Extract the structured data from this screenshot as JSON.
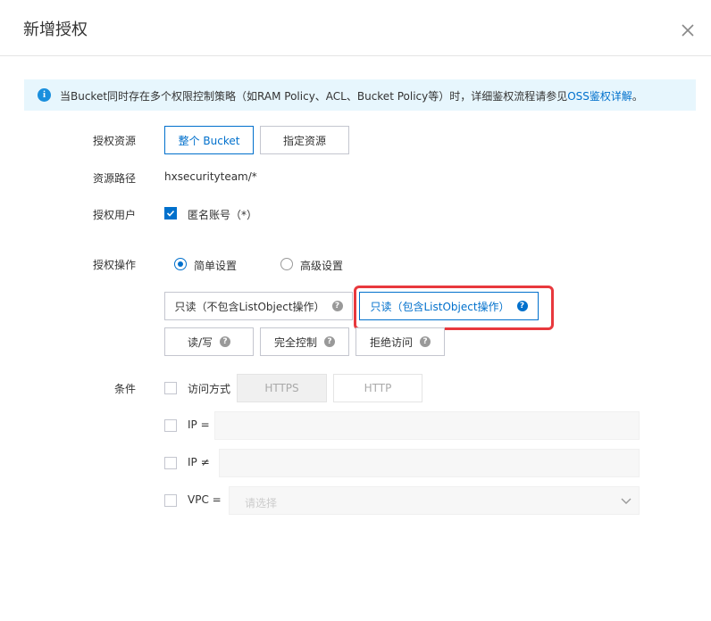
{
  "dialog": {
    "title": "新增授权",
    "notice": {
      "text": "当Bucket同时存在多个权限控制策略（如RAM Policy、ACL、Bucket Policy等）时，详细鉴权流程请参见",
      "link": "OSS鉴权详解",
      "suffix": "。"
    },
    "resource": {
      "label": "授权资源",
      "options": [
        "整个 Bucket",
        "指定资源"
      ]
    },
    "path": {
      "label": "资源路径",
      "value": "hxsecurityteam/*"
    },
    "user": {
      "label": "授权用户",
      "checkbox_label": "匿名账号（*）"
    },
    "operation": {
      "label": "授权操作",
      "modes": [
        "简单设置",
        "高级设置"
      ],
      "actions": [
        "只读（不包含ListObject操作）",
        "只读（包含ListObject操作）",
        "读/写",
        "完全控制",
        "拒绝访问"
      ],
      "help_glyph": "?"
    },
    "condition": {
      "label": "条件",
      "access_label": "访问方式",
      "protocols": [
        "HTTPS",
        "HTTP"
      ],
      "ip_eq_label": "IP =",
      "ip_ne_label": "IP ≠",
      "vpc_label": "VPC =",
      "vpc_placeholder": "请选择"
    },
    "info_glyph": "i"
  },
  "colors": {
    "accent": "#0070cc",
    "highlight": "#e8383d",
    "notice_bg": "#e7f6fd"
  }
}
